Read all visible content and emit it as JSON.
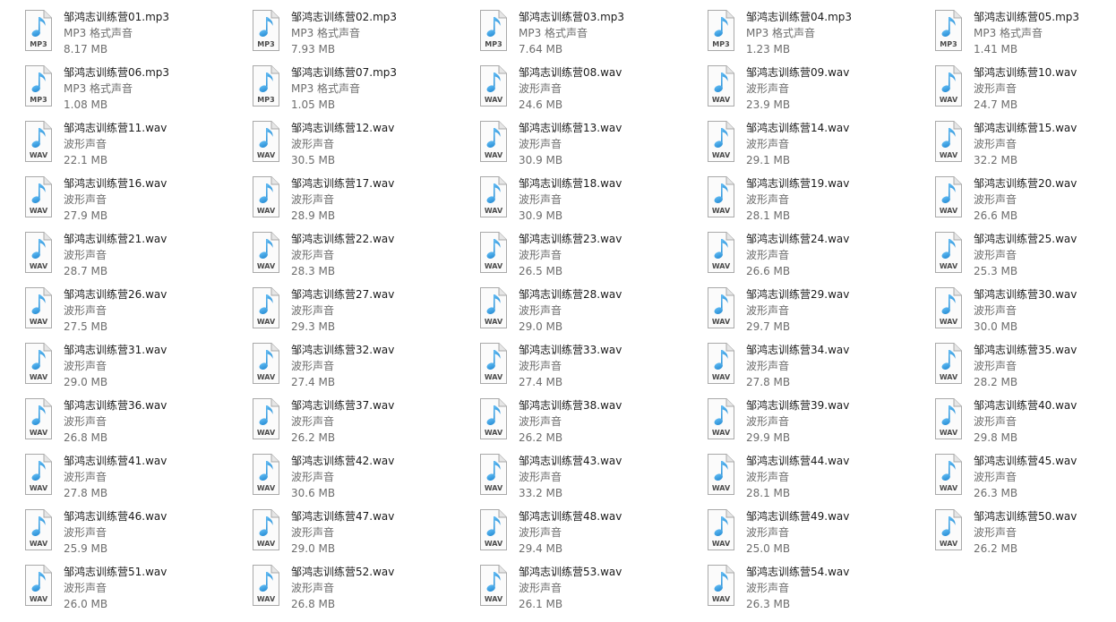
{
  "type_labels": {
    "mp3": "MP3 格式声音",
    "wav": "波形声音"
  },
  "icon_badges": {
    "mp3": "MP3",
    "wav": "WAV"
  },
  "colors": {
    "note_blue": "#2a8fd6",
    "badge_text": "#4b4b4b"
  },
  "files": [
    {
      "name": "邹鸿志训练营01.mp3",
      "kind": "mp3",
      "size": "8.17 MB"
    },
    {
      "name": "邹鸿志训练营02.mp3",
      "kind": "mp3",
      "size": "7.93 MB"
    },
    {
      "name": "邹鸿志训练营03.mp3",
      "kind": "mp3",
      "size": "7.64 MB"
    },
    {
      "name": "邹鸿志训练营04.mp3",
      "kind": "mp3",
      "size": "1.23 MB"
    },
    {
      "name": "邹鸿志训练营05.mp3",
      "kind": "mp3",
      "size": "1.41 MB"
    },
    {
      "name": "邹鸿志训练营06.mp3",
      "kind": "mp3",
      "size": "1.08 MB"
    },
    {
      "name": "邹鸿志训练营07.mp3",
      "kind": "mp3",
      "size": "1.05 MB"
    },
    {
      "name": "邹鸿志训练营08.wav",
      "kind": "wav",
      "size": "24.6 MB"
    },
    {
      "name": "邹鸿志训练营09.wav",
      "kind": "wav",
      "size": "23.9 MB"
    },
    {
      "name": "邹鸿志训练营10.wav",
      "kind": "wav",
      "size": "24.7 MB"
    },
    {
      "name": "邹鸿志训练营11.wav",
      "kind": "wav",
      "size": "22.1 MB"
    },
    {
      "name": "邹鸿志训练营12.wav",
      "kind": "wav",
      "size": "30.5 MB"
    },
    {
      "name": "邹鸿志训练营13.wav",
      "kind": "wav",
      "size": "30.9 MB"
    },
    {
      "name": "邹鸿志训练营14.wav",
      "kind": "wav",
      "size": "29.1 MB"
    },
    {
      "name": "邹鸿志训练营15.wav",
      "kind": "wav",
      "size": "32.2 MB"
    },
    {
      "name": "邹鸿志训练营16.wav",
      "kind": "wav",
      "size": "27.9 MB"
    },
    {
      "name": "邹鸿志训练营17.wav",
      "kind": "wav",
      "size": "28.9 MB"
    },
    {
      "name": "邹鸿志训练营18.wav",
      "kind": "wav",
      "size": "30.9 MB"
    },
    {
      "name": "邹鸿志训练营19.wav",
      "kind": "wav",
      "size": "28.1 MB"
    },
    {
      "name": "邹鸿志训练营20.wav",
      "kind": "wav",
      "size": "26.6 MB"
    },
    {
      "name": "邹鸿志训练营21.wav",
      "kind": "wav",
      "size": "28.7 MB"
    },
    {
      "name": "邹鸿志训练营22.wav",
      "kind": "wav",
      "size": "28.3 MB"
    },
    {
      "name": "邹鸿志训练营23.wav",
      "kind": "wav",
      "size": "26.5 MB"
    },
    {
      "name": "邹鸿志训练营24.wav",
      "kind": "wav",
      "size": "26.6 MB"
    },
    {
      "name": "邹鸿志训练营25.wav",
      "kind": "wav",
      "size": "25.3 MB"
    },
    {
      "name": "邹鸿志训练营26.wav",
      "kind": "wav",
      "size": "27.5 MB"
    },
    {
      "name": "邹鸿志训练营27.wav",
      "kind": "wav",
      "size": "29.3 MB"
    },
    {
      "name": "邹鸿志训练营28.wav",
      "kind": "wav",
      "size": "29.0 MB"
    },
    {
      "name": "邹鸿志训练营29.wav",
      "kind": "wav",
      "size": "29.7 MB"
    },
    {
      "name": "邹鸿志训练营30.wav",
      "kind": "wav",
      "size": "30.0 MB"
    },
    {
      "name": "邹鸿志训练营31.wav",
      "kind": "wav",
      "size": "29.0 MB"
    },
    {
      "name": "邹鸿志训练营32.wav",
      "kind": "wav",
      "size": "27.4 MB"
    },
    {
      "name": "邹鸿志训练营33.wav",
      "kind": "wav",
      "size": "27.4 MB"
    },
    {
      "name": "邹鸿志训练营34.wav",
      "kind": "wav",
      "size": "27.8 MB"
    },
    {
      "name": "邹鸿志训练营35.wav",
      "kind": "wav",
      "size": "28.2 MB"
    },
    {
      "name": "邹鸿志训练营36.wav",
      "kind": "wav",
      "size": "26.8 MB"
    },
    {
      "name": "邹鸿志训练营37.wav",
      "kind": "wav",
      "size": "26.2 MB"
    },
    {
      "name": "邹鸿志训练营38.wav",
      "kind": "wav",
      "size": "26.2 MB"
    },
    {
      "name": "邹鸿志训练营39.wav",
      "kind": "wav",
      "size": "29.9 MB"
    },
    {
      "name": "邹鸿志训练营40.wav",
      "kind": "wav",
      "size": "29.8 MB"
    },
    {
      "name": "邹鸿志训练营41.wav",
      "kind": "wav",
      "size": "27.8 MB"
    },
    {
      "name": "邹鸿志训练营42.wav",
      "kind": "wav",
      "size": "30.6 MB"
    },
    {
      "name": "邹鸿志训练营43.wav",
      "kind": "wav",
      "size": "33.2 MB"
    },
    {
      "name": "邹鸿志训练营44.wav",
      "kind": "wav",
      "size": "28.1 MB"
    },
    {
      "name": "邹鸿志训练营45.wav",
      "kind": "wav",
      "size": "26.3 MB"
    },
    {
      "name": "邹鸿志训练营46.wav",
      "kind": "wav",
      "size": "25.9 MB"
    },
    {
      "name": "邹鸿志训练营47.wav",
      "kind": "wav",
      "size": "29.0 MB"
    },
    {
      "name": "邹鸿志训练营48.wav",
      "kind": "wav",
      "size": "29.4 MB"
    },
    {
      "name": "邹鸿志训练营49.wav",
      "kind": "wav",
      "size": "25.0 MB"
    },
    {
      "name": "邹鸿志训练营50.wav",
      "kind": "wav",
      "size": "26.2 MB"
    },
    {
      "name": "邹鸿志训练营51.wav",
      "kind": "wav",
      "size": "26.0 MB"
    },
    {
      "name": "邹鸿志训练营52.wav",
      "kind": "wav",
      "size": "26.8 MB"
    },
    {
      "name": "邹鸿志训练营53.wav",
      "kind": "wav",
      "size": "26.1 MB"
    },
    {
      "name": "邹鸿志训练营54.wav",
      "kind": "wav",
      "size": "26.3 MB"
    }
  ]
}
